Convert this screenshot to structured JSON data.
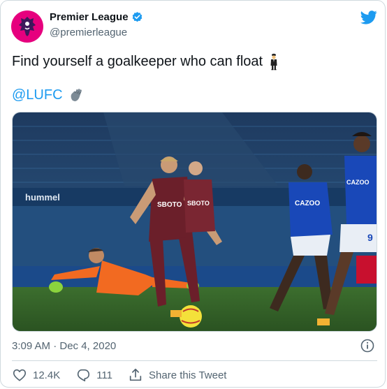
{
  "account": {
    "name": "Premier League",
    "handle": "@premierleague",
    "verified": true,
    "avatar_color": "#e6007e"
  },
  "tweet": {
    "text": "Find yourself a goalkeeper who can float",
    "text_emoji": "man-in-business-suit-levitating",
    "mention": "@LUFC",
    "mention_emoji": "waving-hand",
    "timestamp": "3:09 AM · Dec 4, 2020"
  },
  "media": {
    "pitch_ad_text": "hummel",
    "sponsor_leeds": "SBOTO",
    "sponsor_everton": "CAZOO",
    "player_number": "9"
  },
  "actions": {
    "likes": "12.4K",
    "replies": "111",
    "share_label": "Share this Tweet"
  },
  "colors": {
    "link": "#1d9bf0",
    "secondary_text": "#536471",
    "border": "#cfd9de"
  }
}
